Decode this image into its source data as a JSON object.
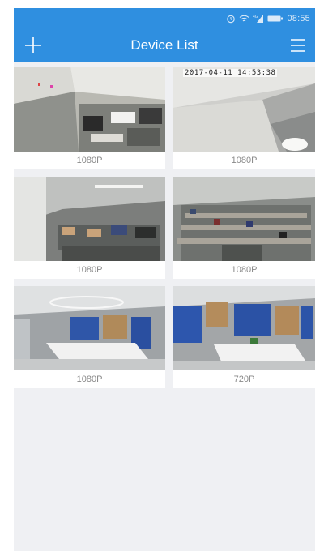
{
  "status_bar": {
    "time": "08:55",
    "icons": [
      "alarm-icon",
      "wifi-icon",
      "signal-icon",
      "battery-icon"
    ]
  },
  "header": {
    "title": "Device List",
    "add_icon": "plus-icon",
    "menu_icon": "hamburger-menu-icon"
  },
  "devices": [
    {
      "resolution": "1080P",
      "osd": ""
    },
    {
      "resolution": "1080P",
      "osd": "2017-04-11 14:53:38"
    },
    {
      "resolution": "1080P",
      "osd": ""
    },
    {
      "resolution": "1080P",
      "osd": ""
    },
    {
      "resolution": "1080P",
      "osd": ""
    },
    {
      "resolution": "720P",
      "osd": ""
    }
  ],
  "colors": {
    "header_blue": "#2f8fe0",
    "background": "#eff0f3",
    "label_gray": "#8a8a8a"
  }
}
